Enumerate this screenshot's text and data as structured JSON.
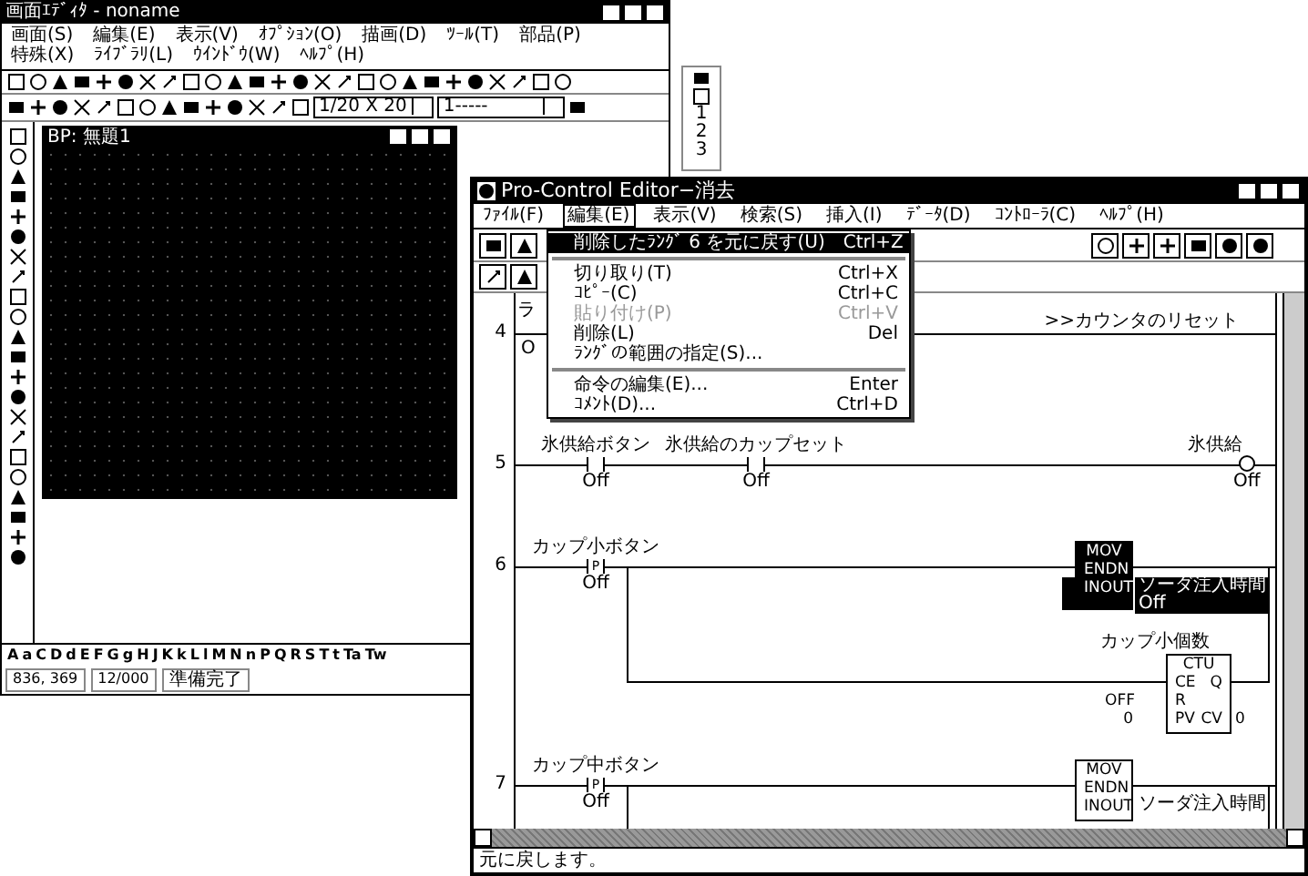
{
  "bg_window": {
    "title": "画面ｴﾃﾞｨﾀ - noname",
    "menu": [
      "画面(S)",
      "編集(E)",
      "表示(V)",
      "ｵﾌﾟｼｮﾝ(O)",
      "描画(D)",
      "ﾂｰﾙ(T)",
      "部品(P)",
      "特殊(X)",
      "ﾗｲﾌﾞﾗﾘ(L)",
      "ｳｲﾝﾄﾞｳ(W)",
      "ﾍﾙﾌﾟ(H)"
    ],
    "zoom_select": "1/20 X 20",
    "line_select": "1-----",
    "child_window": {
      "title": "BP: 無題1"
    },
    "side_panel": [
      "1",
      "2",
      "3"
    ],
    "font_bar": [
      "A",
      "a",
      "C",
      "D",
      "d",
      "E",
      "F",
      "G",
      "g",
      "H",
      "J",
      "K",
      "k",
      "L",
      "l",
      "M",
      "N",
      "n",
      "P",
      "Q",
      "R",
      "S",
      "T",
      "t",
      "Ta",
      "Tw"
    ],
    "status_bar": [
      "836, 369",
      "12/000",
      "準備完了"
    ]
  },
  "editor": {
    "title": "Pro-Control Editor−消去",
    "menu": [
      {
        "label": "ﾌｧｲﾙ(F)",
        "selected": false
      },
      {
        "label": "編集(E)",
        "selected": true
      },
      {
        "label": "表示(V)",
        "selected": false
      },
      {
        "label": "検索(S)",
        "selected": false
      },
      {
        "label": "挿入(I)",
        "selected": false
      },
      {
        "label": "ﾃﾞｰﾀ(D)",
        "selected": false
      },
      {
        "label": "ｺﾝﾄﾛｰﾗ(C)",
        "selected": false
      },
      {
        "label": "ﾍﾙﾌﾟ(H)",
        "selected": false
      }
    ],
    "edit_menu": [
      {
        "kind": "item",
        "label": "削除したﾗﾝｸﾞ 6 を元に戻す(U)",
        "shortcut": "Ctrl+Z",
        "highlighted": true,
        "disabled": false
      },
      {
        "kind": "separator"
      },
      {
        "kind": "item",
        "label": "切り取り(T)",
        "shortcut": "Ctrl+X",
        "highlighted": false,
        "disabled": false
      },
      {
        "kind": "item",
        "label": "ｺﾋﾟｰ(C)",
        "shortcut": "Ctrl+C",
        "highlighted": false,
        "disabled": false
      },
      {
        "kind": "item",
        "label": "貼り付け(P)",
        "shortcut": "Ctrl+V",
        "highlighted": false,
        "disabled": true
      },
      {
        "kind": "item",
        "label": "削除(L)",
        "shortcut": "Del",
        "highlighted": false,
        "disabled": false
      },
      {
        "kind": "item",
        "label": "ﾗﾝｸﾞの範囲の指定(S)...",
        "highlighted": false,
        "disabled": false
      },
      {
        "kind": "separator"
      },
      {
        "kind": "item",
        "label": "命令の編集(E)...",
        "shortcut": "Enter",
        "highlighted": false,
        "disabled": false
      },
      {
        "kind": "item",
        "label": "ｺﾒﾝﾄ(D)...",
        "shortcut": "Ctrl+D",
        "highlighted": false,
        "disabled": false
      }
    ],
    "rungs": [
      {
        "number": "4",
        "label": "ラ",
        "state": "O",
        "comment": ">>カウンタのリセット"
      },
      {
        "number": "5",
        "contacts": [
          {
            "label": "氷供給ボタン",
            "state": "Off"
          },
          {
            "label": "氷供給のカップセット",
            "state": "Off"
          }
        ],
        "coil": {
          "label": "氷供給",
          "state": "Off"
        }
      },
      {
        "number": "6",
        "contacts": [
          {
            "label": "カップ小ボタン",
            "symbol": "P",
            "state": "Off"
          }
        ],
        "blocks": [
          {
            "kind": "mov",
            "name": "MOV",
            "pins": [
              "EN",
              "DN",
              "IN",
              "OUT"
            ],
            "output": "ソーダ注入時間",
            "output_state": "Off",
            "selected": true
          },
          {
            "kind": "ctu",
            "label": "カップ小個数",
            "name": "CTU",
            "pins": [
              "CE",
              "Q",
              "R",
              "PV",
              "CV"
            ],
            "r_value": "OFF",
            "pv_value": "0",
            "cv_value": "0"
          }
        ]
      },
      {
        "number": "7",
        "contacts": [
          {
            "label": "カップ中ボタン",
            "symbol": "P",
            "state": "Off"
          }
        ],
        "blocks": [
          {
            "kind": "mov",
            "name": "MOV",
            "pins": [
              "EN",
              "DN",
              "IN",
              "OUT"
            ],
            "output": "ソーダ注入時間",
            "selected": false
          }
        ]
      }
    ],
    "status_bar": "元に戻します。"
  }
}
